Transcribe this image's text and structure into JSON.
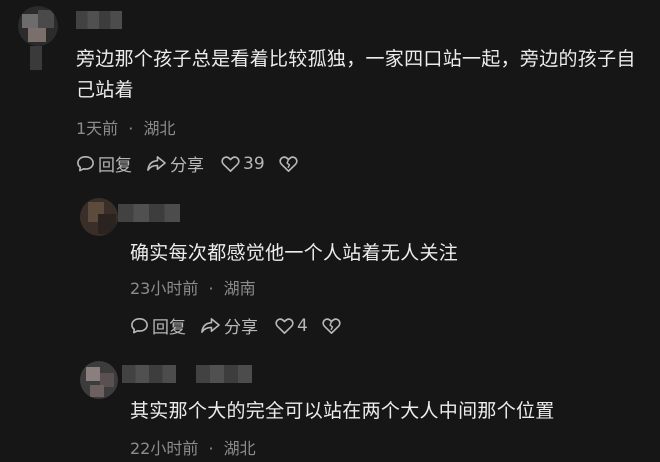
{
  "comments": [
    {
      "text": "旁边那个孩子总是看着比较孤独，一家四口站一起，旁边的孩子自己站着",
      "time": "1天前",
      "location": "湖北",
      "reply_label": "回复",
      "share_label": "分享",
      "likes": "39"
    },
    {
      "text": "确实每次都感觉他一个人站着无人关注",
      "time": "23小时前",
      "location": "湖南",
      "reply_label": "回复",
      "share_label": "分享",
      "likes": "4"
    },
    {
      "text": "其实那个大的完全可以站在两个大人中间那个位置",
      "time": "22小时前",
      "location": "湖北"
    }
  ],
  "separator": "·",
  "colors": {
    "background": "#161616",
    "text": "#ececec",
    "meta": "#8c8c8c",
    "action": "#b8b8b8"
  }
}
